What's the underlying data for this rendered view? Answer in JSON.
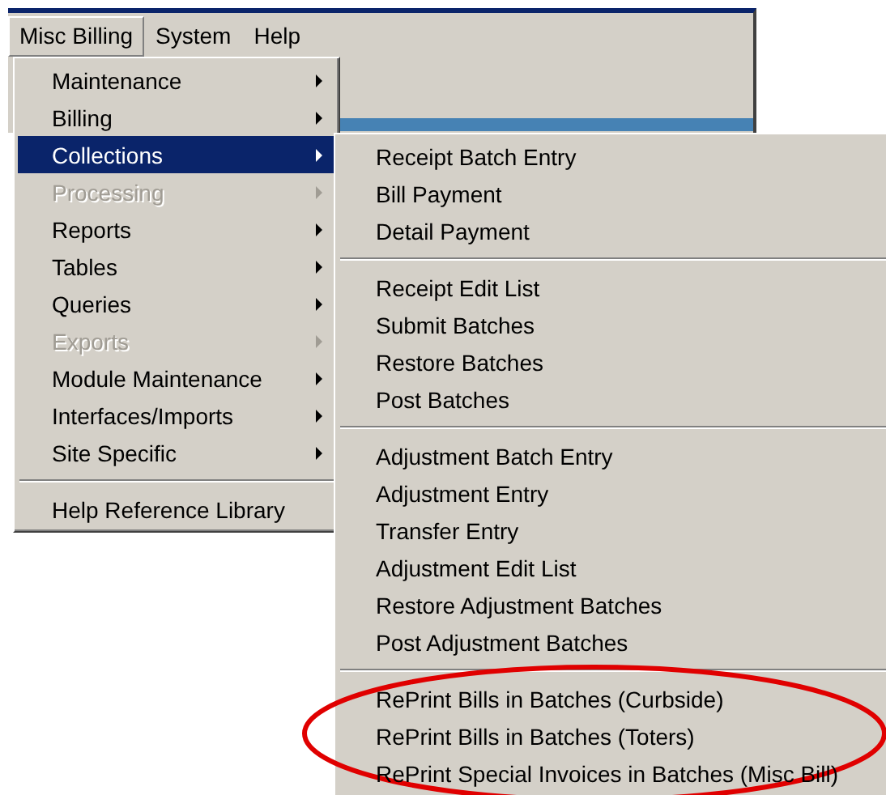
{
  "menu_bar": [
    {
      "label": "Misc Billing",
      "selected": true
    },
    {
      "label": "System",
      "selected": false
    },
    {
      "label": "Help",
      "selected": false
    }
  ],
  "main_menu": [
    {
      "kind": "item",
      "label": "Maintenance",
      "submenu": true,
      "disabled": false,
      "selected": false
    },
    {
      "kind": "item",
      "label": "Billing",
      "submenu": true,
      "disabled": false,
      "selected": false
    },
    {
      "kind": "item",
      "label": "Collections",
      "submenu": true,
      "disabled": false,
      "selected": true
    },
    {
      "kind": "item",
      "label": "Processing",
      "submenu": true,
      "disabled": true,
      "selected": false
    },
    {
      "kind": "item",
      "label": "Reports",
      "submenu": true,
      "disabled": false,
      "selected": false
    },
    {
      "kind": "item",
      "label": "Tables",
      "submenu": true,
      "disabled": false,
      "selected": false
    },
    {
      "kind": "item",
      "label": "Queries",
      "submenu": true,
      "disabled": false,
      "selected": false
    },
    {
      "kind": "item",
      "label": "Exports",
      "submenu": true,
      "disabled": true,
      "selected": false
    },
    {
      "kind": "item",
      "label": "Module Maintenance",
      "submenu": true,
      "disabled": false,
      "selected": false
    },
    {
      "kind": "item",
      "label": "Interfaces/Imports",
      "submenu": true,
      "disabled": false,
      "selected": false
    },
    {
      "kind": "item",
      "label": "Site Specific",
      "submenu": true,
      "disabled": false,
      "selected": false
    },
    {
      "kind": "separator"
    },
    {
      "kind": "item",
      "label": "Help Reference Library",
      "submenu": false,
      "disabled": false,
      "selected": false
    }
  ],
  "collections_submenu": [
    {
      "kind": "item",
      "label": "Receipt Batch Entry"
    },
    {
      "kind": "item",
      "label": "Bill Payment"
    },
    {
      "kind": "item",
      "label": "Detail Payment"
    },
    {
      "kind": "separator"
    },
    {
      "kind": "item",
      "label": "Receipt Edit List"
    },
    {
      "kind": "item",
      "label": "Submit Batches"
    },
    {
      "kind": "item",
      "label": "Restore Batches"
    },
    {
      "kind": "item",
      "label": "Post Batches"
    },
    {
      "kind": "separator"
    },
    {
      "kind": "item",
      "label": "Adjustment Batch Entry"
    },
    {
      "kind": "item",
      "label": "Adjustment Entry"
    },
    {
      "kind": "item",
      "label": "Transfer Entry"
    },
    {
      "kind": "item",
      "label": "Adjustment Edit List"
    },
    {
      "kind": "item",
      "label": "Restore Adjustment Batches"
    },
    {
      "kind": "item",
      "label": "Post Adjustment Batches"
    },
    {
      "kind": "separator"
    },
    {
      "kind": "item",
      "label": "RePrint Bills in Batches (Curbside)"
    },
    {
      "kind": "item",
      "label": "RePrint Bills in Batches (Toters)"
    },
    {
      "kind": "item",
      "label": "RePrint Special Invoices in Batches (Misc Bill)"
    }
  ]
}
